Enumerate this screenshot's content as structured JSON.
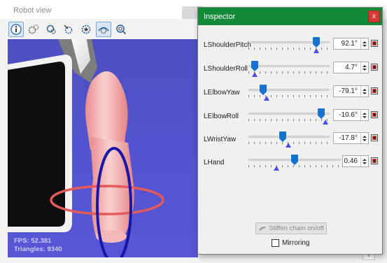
{
  "robot_view": {
    "title": "Robot view",
    "toolbar": [
      {
        "icon": "info-icon",
        "active": true
      },
      {
        "icon": "gears-icon",
        "active": false
      },
      {
        "icon": "magnify-gear-icon",
        "active": false
      },
      {
        "icon": "tools-gear-icon",
        "active": false
      },
      {
        "icon": "gear-star-icon",
        "active": false
      },
      {
        "icon": "camera-eye-icon",
        "active": true
      },
      {
        "icon": "zoom-gear-icon",
        "active": false
      }
    ],
    "fps_text": "FPS: 52.381",
    "triangles_text": "Triangles: 9340"
  },
  "inspector": {
    "title": "Inspector",
    "close_label": "x",
    "joints": [
      {
        "name": "LShoulderPitch",
        "value": "92.1°",
        "thumb": 0.84,
        "actual": 0.84
      },
      {
        "name": "LShoulderRoll",
        "value": "4.7°",
        "thumb": 0.08,
        "actual": 0.08
      },
      {
        "name": "LElbowYaw",
        "value": "-79.1°",
        "thumb": 0.18,
        "actual": 0.22
      },
      {
        "name": "LElbowRoll",
        "value": "-10.6°",
        "thumb": 0.9,
        "actual": 0.95
      },
      {
        "name": "LWristYaw",
        "value": "-17.8°",
        "thumb": 0.42,
        "actual": 0.49
      },
      {
        "name": "LHand",
        "value": "0.46",
        "thumb": 0.5,
        "actual": 0.3
      }
    ],
    "stiffen_label": "Stiffen chain on/off",
    "mirroring_label": "Mirroring",
    "mirroring_checked": false,
    "colors": {
      "title_bar": "#128a3a",
      "close": "#d53b33",
      "thumb": "#1373cf",
      "actual_marker": "#4c4cea",
      "viewport": "#5353cf"
    }
  }
}
